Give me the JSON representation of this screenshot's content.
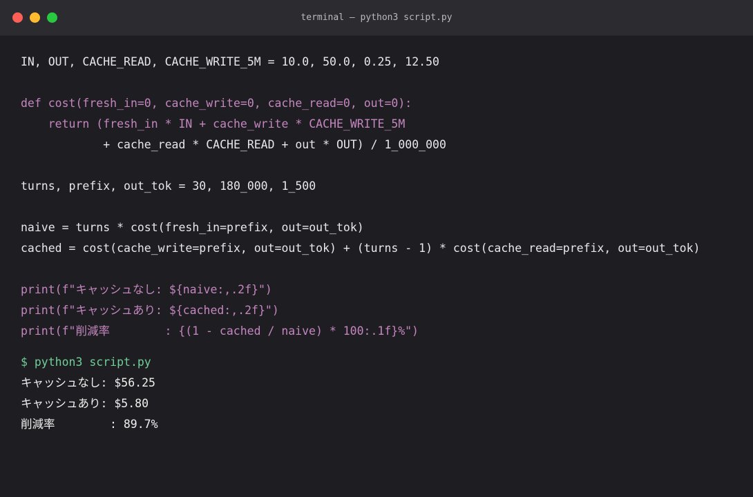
{
  "window": {
    "title": "terminal — python3 script.py"
  },
  "code": {
    "l1": "IN, OUT, CACHE_READ, CACHE_WRITE_5M = 10.0, 50.0, 0.25, 12.50",
    "l2": "def cost(fresh_in=0, cache_write=0, cache_read=0, out=0):",
    "l3": "    return (fresh_in * IN + cache_write * CACHE_WRITE_5M",
    "l4": "            + cache_read * CACHE_READ + out * OUT) / 1_000_000",
    "l5": "turns, prefix, out_tok = 30, 180_000, 1_500",
    "l6": "naive = turns * cost(fresh_in=prefix, out=out_tok)",
    "l7": "cached = cost(cache_write=prefix, out=out_tok) + (turns - 1) * cost(cache_read=prefix, out=out_tok)",
    "l8": "print(f\"キャッシュなし: ${naive:,.2f}\")",
    "l9": "print(f\"キャッシュあり: ${cached:,.2f}\")",
    "l10": "print(f\"削減率        : {(1 - cached / naive) * 100:.1f}%\")"
  },
  "terminal": {
    "command": "$ python3 script.py",
    "output": [
      "キャッシュなし: $56.25",
      "キャッシュあり: $5.80",
      "削減率        : 89.7%"
    ]
  },
  "colors": {
    "background": "#1e1e22",
    "titlebar": "#2b2b30",
    "code_text": "#e8e8ea",
    "keyword": "#c586c0",
    "prompt": "#6fcf97"
  }
}
